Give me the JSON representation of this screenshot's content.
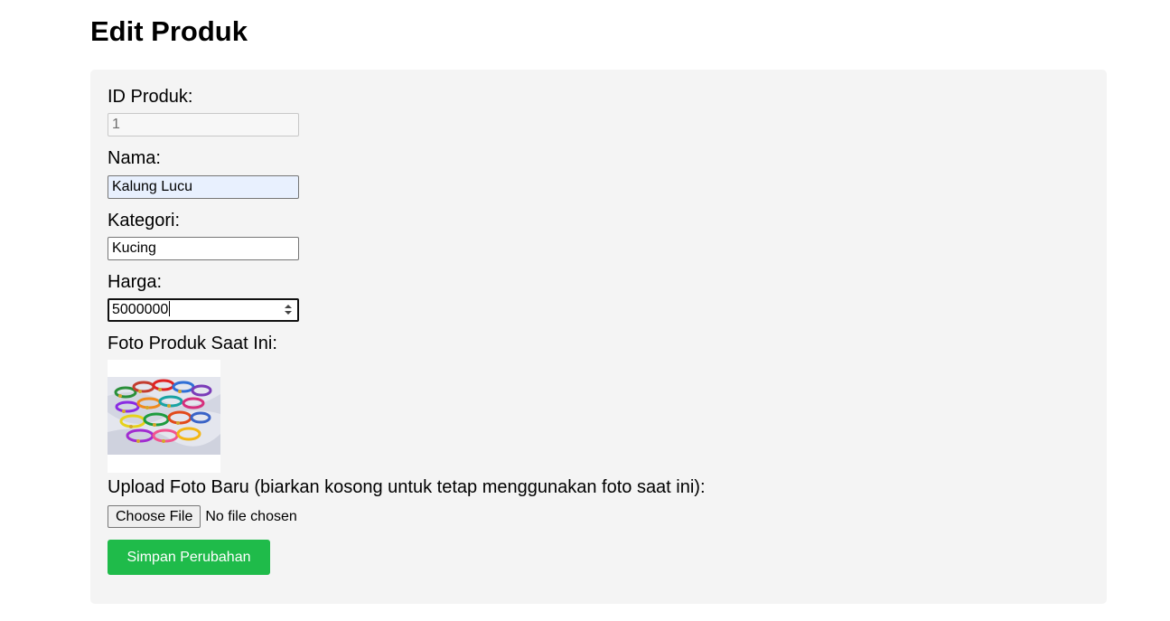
{
  "page": {
    "title": "Edit Produk"
  },
  "form": {
    "id_label": "ID Produk:",
    "id_value": "1",
    "name_label": "Nama:",
    "name_value": "Kalung Lucu",
    "category_label": "Kategori:",
    "category_value": "Kucing",
    "price_label": "Harga:",
    "price_value": "5000000",
    "current_photo_label": "Foto Produk Saat Ini:",
    "upload_label": "Upload Foto Baru (biarkan kosong untuk tetap menggunakan foto saat ini):",
    "choose_file_label": "Choose File",
    "file_status": "No file chosen",
    "submit_label": "Simpan Perubahan"
  },
  "colors": {
    "card_background": "#f4f4f4",
    "submit_button": "#1fbb4a",
    "autofill_background": "#e8f0fe"
  },
  "icons": {
    "number_spinner": "spinner-arrows-icon"
  }
}
